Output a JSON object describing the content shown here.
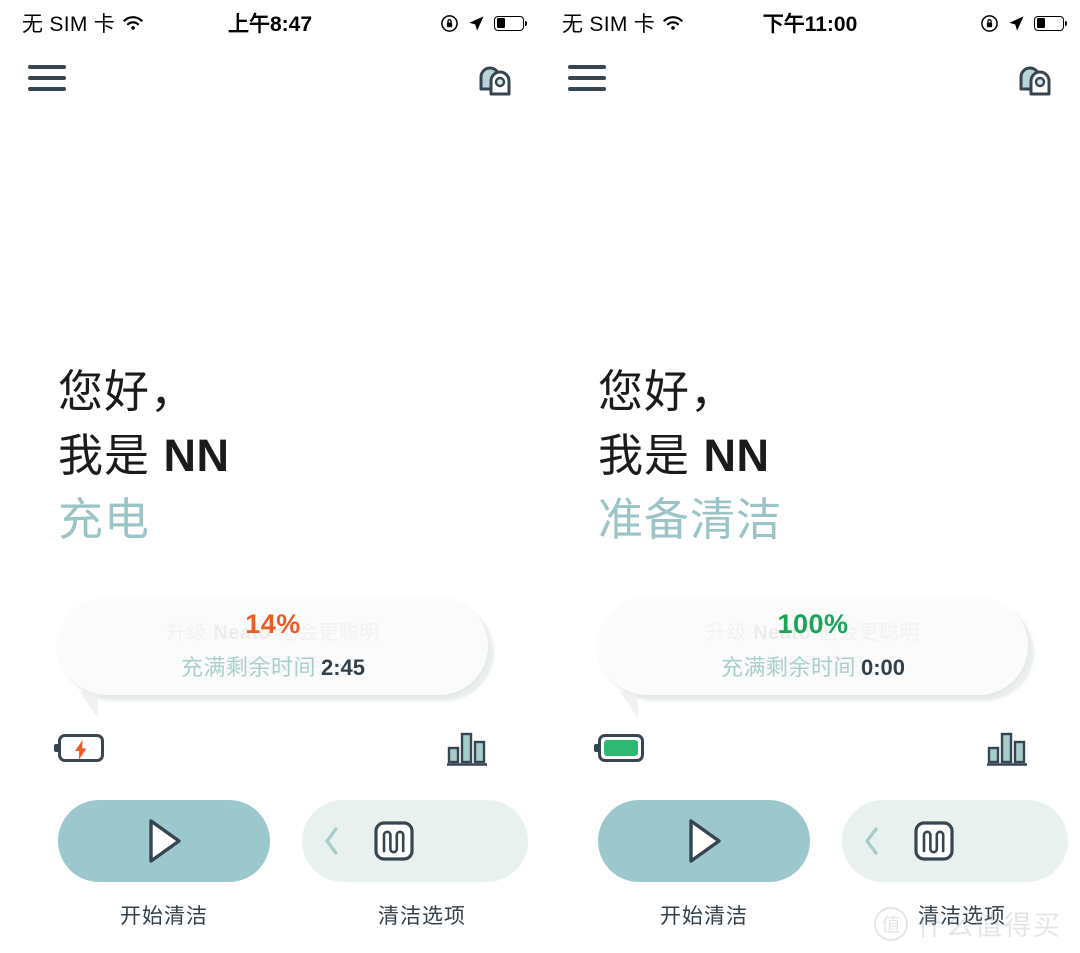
{
  "panels": [
    {
      "status_bar": {
        "carrier": "无 SIM 卡",
        "wifi_icon": "wifi-icon",
        "time": "上午8:47",
        "rotation_lock_icon": "rotation-lock-icon",
        "location_icon": "location-arrow-icon",
        "battery_icon": "battery-icon",
        "battery_level_pct": 35
      },
      "app_bar": {
        "menu_icon": "hamburger-menu-icon",
        "robot_icon": "robot-vacuum-icon"
      },
      "greeting": {
        "line1": "您好，",
        "line2_prefix": "我是 ",
        "line2_name": "NN",
        "status": "充电",
        "status_color": "#9ac4c6"
      },
      "bubble": {
        "promo_prefix": "升级 ",
        "promo_brand": "Neato",
        "promo_suffix": " 他会更聪明",
        "promo_line2": "他会更聪明",
        "percent": "14%",
        "percent_color": "#ef5a25",
        "eta_label": "充满剩余时间",
        "eta_value": "2:45"
      },
      "icons": {
        "battery_status_icon": "battery-charging-icon",
        "battery_fill_color": "#ffffff",
        "bolt_visible": true,
        "chart_icon": "bar-chart-icon"
      },
      "actions": {
        "primary": {
          "icon": "play-icon",
          "label": "开始清洁"
        },
        "secondary": {
          "chevron_icon": "chevron-left-icon",
          "icon": "zigzag-path-icon",
          "label": "清洁选项"
        }
      }
    },
    {
      "status_bar": {
        "carrier": "无 SIM 卡",
        "wifi_icon": "wifi-icon",
        "time": "下午11:00",
        "rotation_lock_icon": "rotation-lock-icon",
        "location_icon": "location-arrow-icon",
        "battery_icon": "battery-icon",
        "battery_level_pct": 35
      },
      "app_bar": {
        "menu_icon": "hamburger-menu-icon",
        "robot_icon": "robot-vacuum-icon"
      },
      "greeting": {
        "line1": "您好，",
        "line2_prefix": "我是 ",
        "line2_name": "NN",
        "status": "准备清洁",
        "status_color": "#9ac4c6"
      },
      "bubble": {
        "promo_prefix": "升级 ",
        "promo_brand": "Neato",
        "promo_suffix": " 他会更聪明",
        "promo_line2": "他会更聪明",
        "percent": "100%",
        "percent_color": "#18a558",
        "eta_label": "充满剩余时间",
        "eta_value": "0:00"
      },
      "icons": {
        "battery_status_icon": "battery-full-icon",
        "battery_fill_color": "#2eb872",
        "bolt_visible": false,
        "chart_icon": "bar-chart-icon"
      },
      "actions": {
        "primary": {
          "icon": "play-icon",
          "label": "开始清洁"
        },
        "secondary": {
          "chevron_icon": "chevron-left-icon",
          "icon": "zigzag-path-icon",
          "label": "清洁选项"
        }
      }
    }
  ],
  "watermark": {
    "badge": "值",
    "text": "什么值得买"
  },
  "theme": {
    "primary_button": "#9cc7cc",
    "secondary_button": "#e8f1ee",
    "ink": "#36454f",
    "muted_teal": "#9ac4c6"
  }
}
